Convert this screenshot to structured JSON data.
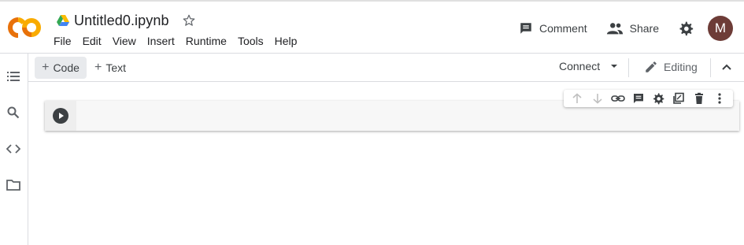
{
  "header": {
    "logo": "colab-logo",
    "notebook_title": "Untitled0.ipynb",
    "menu": [
      "File",
      "Edit",
      "View",
      "Insert",
      "Runtime",
      "Tools",
      "Help"
    ],
    "comment_label": "Comment",
    "share_label": "Share",
    "avatar_initial": "M",
    "avatar_color": "#6d3c37"
  },
  "sidebar": {
    "icons": [
      "table-of-contents-icon",
      "search-icon",
      "code-snippets-icon",
      "files-folder-icon"
    ]
  },
  "toolbar": {
    "add_code_label": "Code",
    "add_text_label": "Text",
    "connect_label": "Connect",
    "editing_label": "Editing"
  },
  "cell_toolbar": {
    "icons": [
      "move-up-icon",
      "move-down-icon",
      "link-icon",
      "comment-icon",
      "settings-icon",
      "mirror-cell-icon",
      "delete-icon",
      "more-icon"
    ]
  },
  "colors": {
    "logo_orange": "#f9ab00",
    "logo_dark_orange": "#e8710a",
    "cell_background": "#f7f7f7",
    "icon_gray": "#5f6368"
  }
}
